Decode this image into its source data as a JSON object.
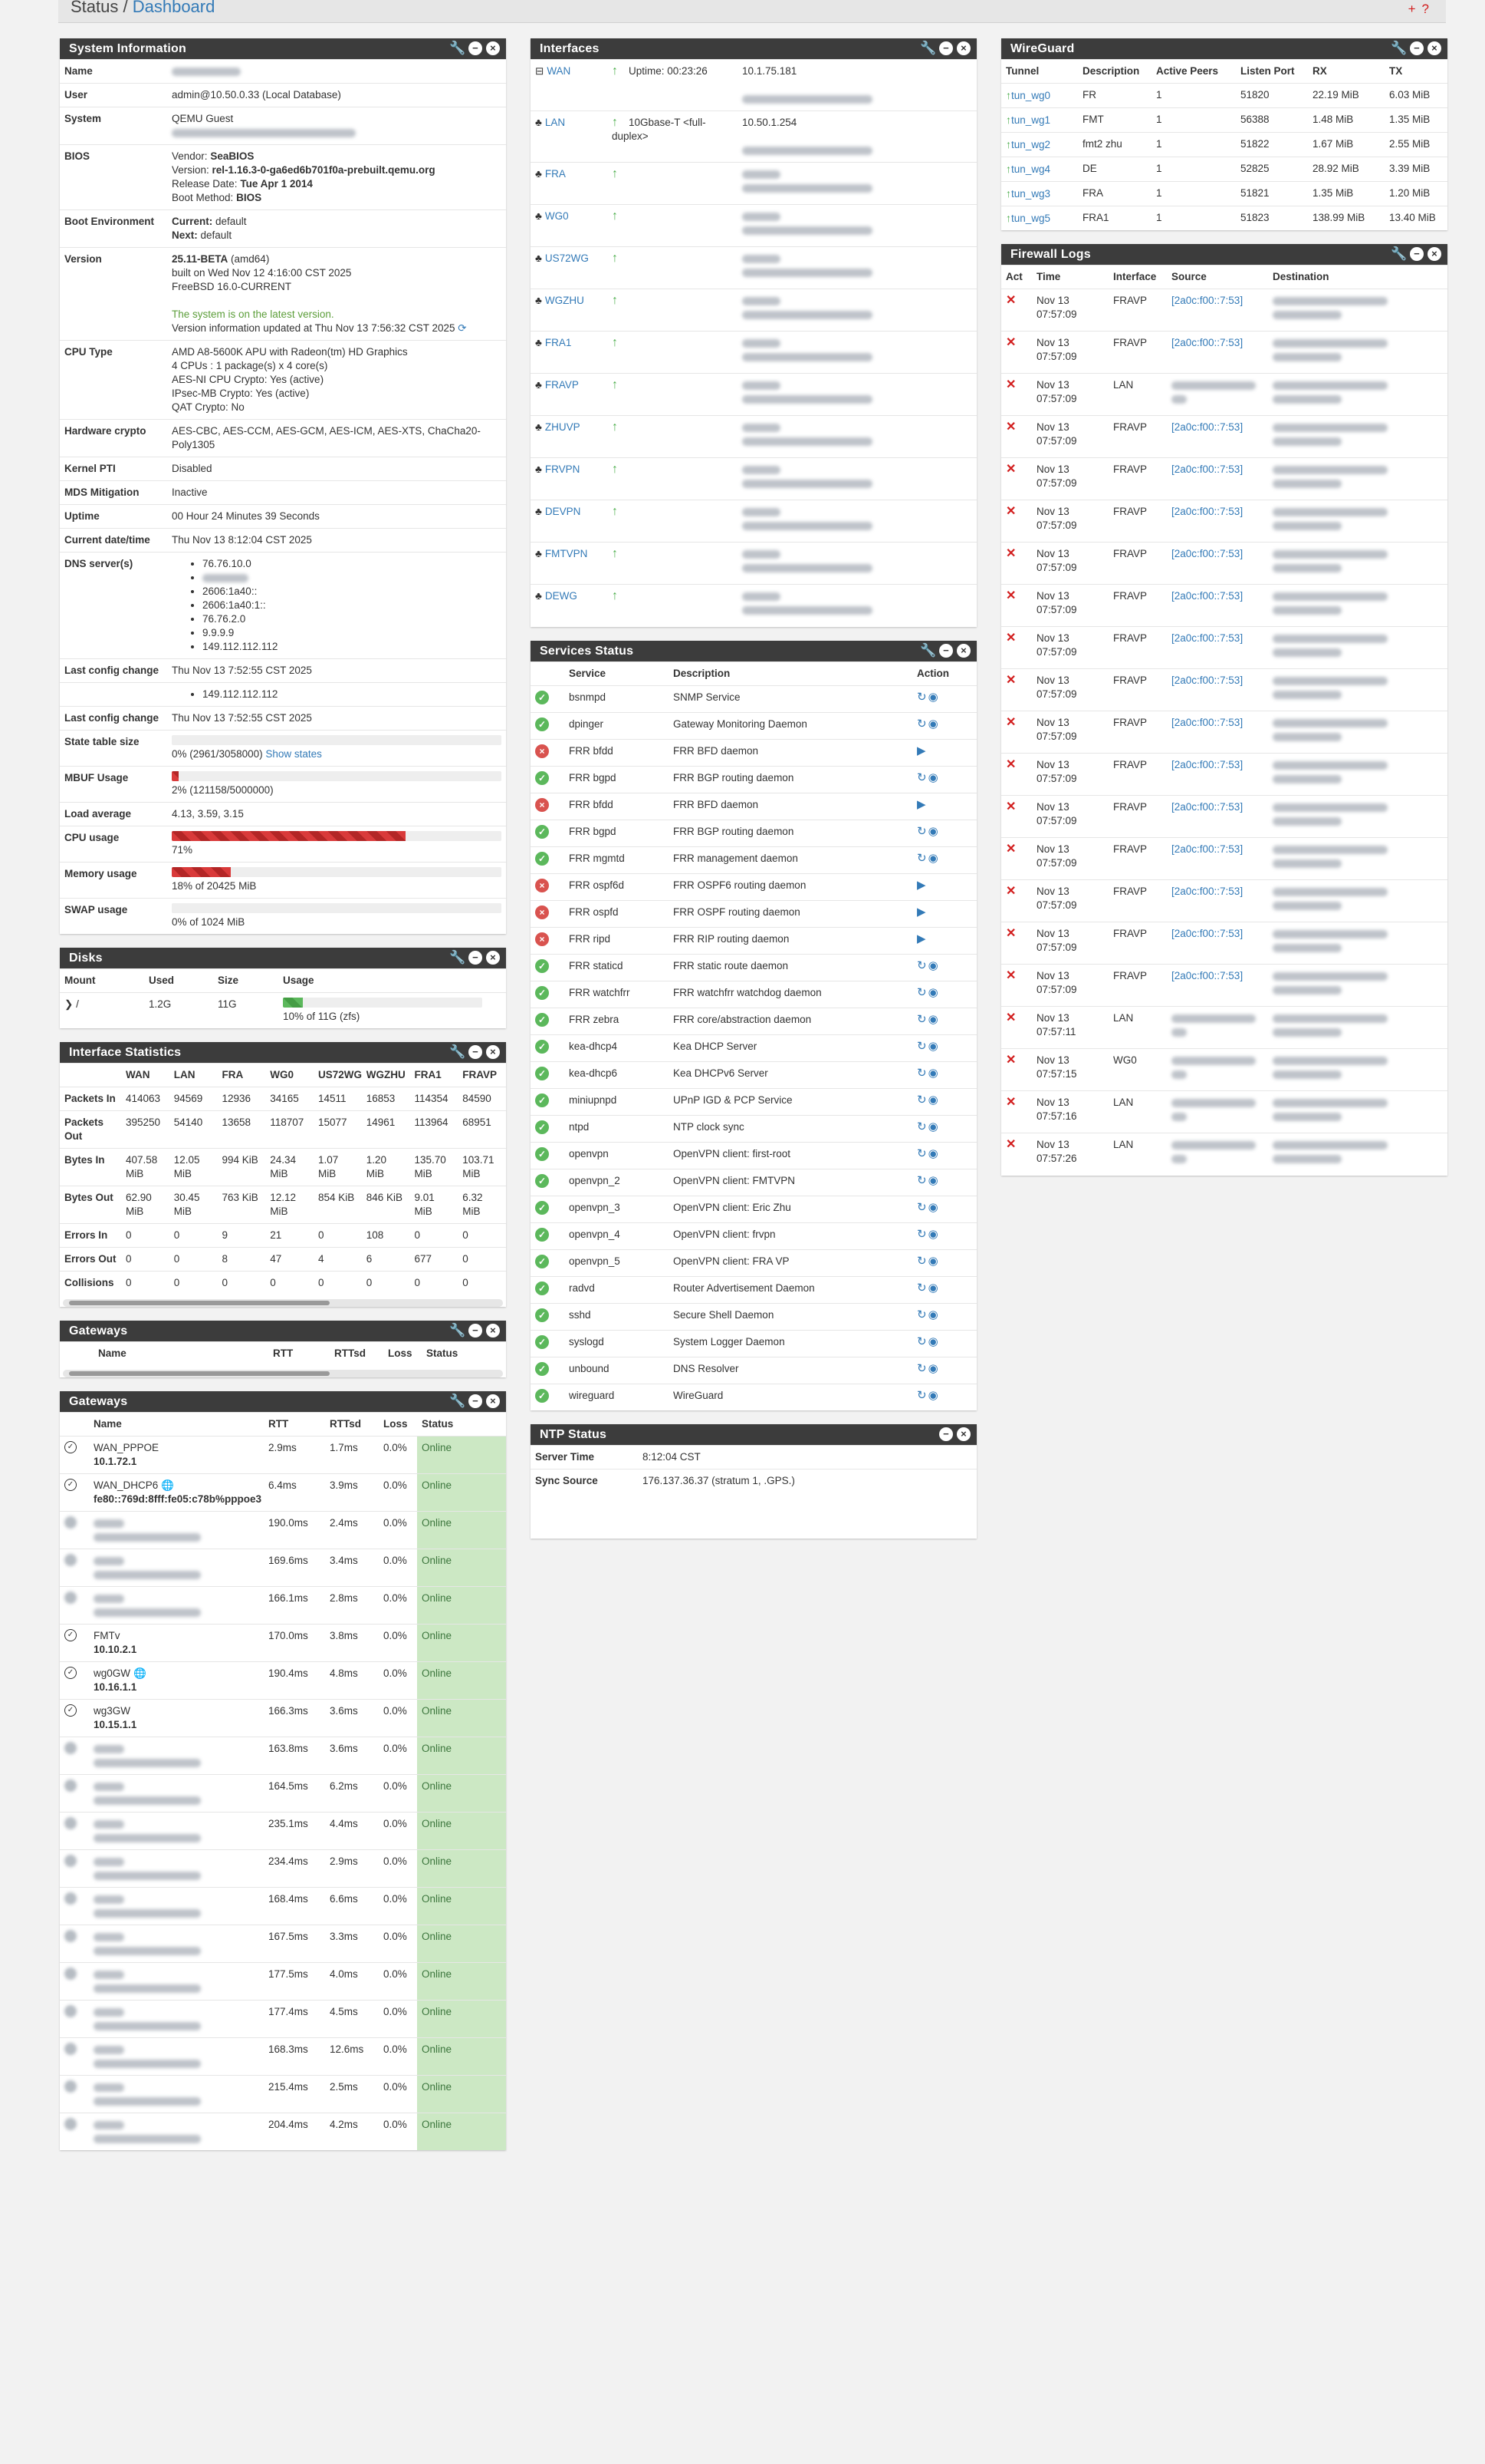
{
  "breadcrumb": {
    "status": "Status /",
    "dashboard": "Dashboard",
    "plus": "+",
    "help": "?"
  },
  "sysinfo": {
    "title": "System Information",
    "user": "admin@10.50.0.33 (Local Database)",
    "system": "QEMU Guest",
    "bios": {
      "vendor_label": "Vendor:",
      "vendor": "SeaBIOS",
      "version_label": "Version:",
      "version": "rel-1.16.3-0-ga6ed6b701f0a-prebuilt.qemu.org",
      "date_label": "Release Date:",
      "date": "Tue Apr 1 2014",
      "method_label": "Boot Method:",
      "method": "BIOS"
    },
    "boot": {
      "current_label": "Current:",
      "current": "default",
      "next_label": "Next:",
      "next": "default"
    },
    "version": {
      "ver": "25.11-BETA",
      "arch": "(amd64)",
      "built": "built on Wed Nov 12 4:16:00 CST 2025",
      "os": "FreeBSD 16.0-CURRENT",
      "latest": "The system is on the latest version.",
      "updated": "Version information updated at Thu Nov 13 7:56:32 CST 2025"
    },
    "cpu": [
      "AMD A8-5600K APU with Radeon(tm) HD Graphics",
      "4 CPUs : 1 package(s) x 4 core(s)",
      "AES-NI CPU Crypto: Yes (active)",
      "IPsec-MB Crypto: Yes (active)",
      "QAT Crypto: No"
    ],
    "hwcrypto": "AES-CBC, AES-CCM, AES-GCM, AES-ICM, AES-XTS, ChaCha20-Poly1305",
    "pti": "Disabled",
    "mds": "Inactive",
    "uptime": "00 Hour 24 Minutes 39 Seconds",
    "datetime": "Thu Nov 13 8:12:04 CST 2025",
    "dns": [
      "76.76.10.0",
      "",
      "2606:1a40::",
      "2606:1a40:1::",
      "76.76.2.0",
      "9.9.9.9",
      "149.112.112.112"
    ],
    "last_config": "Thu Nov 13 7:52:55 CST 2025",
    "dns_extra": "149.112.112.112",
    "last_config2": "Thu Nov 13 7:52:55 CST 2025",
    "state_table": "0% (2961/3058000)",
    "show_states": "Show states",
    "mbuf": "2% (121158/5000000)",
    "mbuf_pct": 2,
    "load": "4.13, 3.59, 3.15",
    "cpu_usage": "71%",
    "cpu_pct": 71,
    "memory": "18% of 20425 MiB",
    "mem_pct": 18,
    "swap": "0% of 1024 MiB",
    "swap_pct": 0,
    "labels": {
      "name": "Name",
      "user": "User",
      "system": "System",
      "bios": "BIOS",
      "boot": "Boot Environment",
      "version": "Version",
      "cpu": "CPU Type",
      "hwcrypto": "Hardware crypto",
      "pti": "Kernel PTI",
      "mds": "MDS Mitigation",
      "uptime": "Uptime",
      "datetime": "Current date/time",
      "dns": "DNS server(s)",
      "last_config": "Last config change",
      "state": "State table size",
      "mbuf": "MBUF Usage",
      "load": "Load average",
      "cpu_usage": "CPU usage",
      "memory": "Memory usage",
      "swap": "SWAP usage"
    }
  },
  "disks": {
    "title": "Disks",
    "headers": [
      "Mount",
      "Used",
      "Size",
      "Usage"
    ],
    "row": {
      "mount": "/",
      "used": "1.2G",
      "size": "11G",
      "usage": "10% of 11G (zfs)",
      "pct": 10
    }
  },
  "ifstats": {
    "title": "Interface Statistics",
    "cols": [
      "WAN",
      "LAN",
      "FRA",
      "WG0",
      "US72WG",
      "WGZHU",
      "FRA1",
      "FRAVP"
    ],
    "rows": [
      {
        "label": "Packets In",
        "vals": [
          "414063",
          "94569",
          "12936",
          "34165",
          "14511",
          "16853",
          "114354",
          "84590"
        ]
      },
      {
        "label": "Packets Out",
        "vals": [
          "395250",
          "54140",
          "13658",
          "118707",
          "15077",
          "14961",
          "113964",
          "68951"
        ]
      },
      {
        "label": "Bytes In",
        "vals": [
          "407.58 MiB",
          "12.05 MiB",
          "994 KiB",
          "24.34 MiB",
          "1.07 MiB",
          "1.20 MiB",
          "135.70 MiB",
          "103.71 MiB"
        ]
      },
      {
        "label": "Bytes Out",
        "vals": [
          "62.90 MiB",
          "30.45 MiB",
          "763 KiB",
          "12.12 MiB",
          "854 KiB",
          "846 KiB",
          "9.01 MiB",
          "6.32 MiB"
        ]
      },
      {
        "label": "Errors In",
        "vals": [
          "0",
          "0",
          "9",
          "21",
          "0",
          "108",
          "0",
          "0"
        ]
      },
      {
        "label": "Errors Out",
        "vals": [
          "0",
          "0",
          "8",
          "47",
          "4",
          "6",
          "677",
          "0"
        ]
      },
      {
        "label": "Collisions",
        "vals": [
          "0",
          "0",
          "0",
          "0",
          "0",
          "0",
          "0",
          "0"
        ]
      }
    ]
  },
  "gateways_empty": {
    "title": "Gateways",
    "headers": [
      "Name",
      "RTT",
      "RTTsd",
      "Loss",
      "Status"
    ]
  },
  "gateways": {
    "title": "Gateways",
    "headers": [
      "Name",
      "RTT",
      "RTTsd",
      "Loss",
      "Status"
    ],
    "rows": [
      {
        "name": "WAN_PPPOE",
        "addr": "10.1.72.1",
        "rtt": "2.9ms",
        "rttsd": "1.7ms",
        "loss": "0.0%",
        "status": "Online",
        "blur": false
      },
      {
        "name": "WAN_DHCP6",
        "addr": "fe80::769d:8fff:fe05:c78b%pppoe3",
        "rtt": "6.4ms",
        "rttsd": "3.9ms",
        "loss": "0.0%",
        "status": "Online",
        "blur": false,
        "globe": true
      },
      {
        "name": "",
        "addr": "",
        "rtt": "190.0ms",
        "rttsd": "2.4ms",
        "loss": "0.0%",
        "status": "Online",
        "blur": true
      },
      {
        "name": "",
        "addr": "",
        "rtt": "169.6ms",
        "rttsd": "3.4ms",
        "loss": "0.0%",
        "status": "Online",
        "blur": true
      },
      {
        "name": "",
        "addr": "",
        "rtt": "166.1ms",
        "rttsd": "2.8ms",
        "loss": "0.0%",
        "status": "Online",
        "blur": true
      },
      {
        "name": "FMTv",
        "addr": "10.10.2.1",
        "rtt": "170.0ms",
        "rttsd": "3.8ms",
        "loss": "0.0%",
        "status": "Online",
        "blur": false
      },
      {
        "name": "wg0GW",
        "addr": "10.16.1.1",
        "rtt": "190.4ms",
        "rttsd": "4.8ms",
        "loss": "0.0%",
        "status": "Online",
        "blur": false,
        "globe": true
      },
      {
        "name": "wg3GW",
        "addr": "10.15.1.1",
        "rtt": "166.3ms",
        "rttsd": "3.6ms",
        "loss": "0.0%",
        "status": "Online",
        "blur": false
      },
      {
        "name": "",
        "addr": "",
        "rtt": "163.8ms",
        "rttsd": "3.6ms",
        "loss": "0.0%",
        "status": "Online",
        "blur": true
      },
      {
        "name": "",
        "addr": "",
        "rtt": "164.5ms",
        "rttsd": "6.2ms",
        "loss": "0.0%",
        "status": "Online",
        "blur": true
      },
      {
        "name": "",
        "addr": "",
        "rtt": "235.1ms",
        "rttsd": "4.4ms",
        "loss": "0.0%",
        "status": "Online",
        "blur": true
      },
      {
        "name": "",
        "addr": "",
        "rtt": "234.4ms",
        "rttsd": "2.9ms",
        "loss": "0.0%",
        "status": "Online",
        "blur": true
      },
      {
        "name": "",
        "addr": "",
        "rtt": "168.4ms",
        "rttsd": "6.6ms",
        "loss": "0.0%",
        "status": "Online",
        "blur": true
      },
      {
        "name": "",
        "addr": "",
        "rtt": "167.5ms",
        "rttsd": "3.3ms",
        "loss": "0.0%",
        "status": "Online",
        "blur": true
      },
      {
        "name": "",
        "addr": "",
        "rtt": "177.5ms",
        "rttsd": "4.0ms",
        "loss": "0.0%",
        "status": "Online",
        "blur": true
      },
      {
        "name": "",
        "addr": "",
        "rtt": "177.4ms",
        "rttsd": "4.5ms",
        "loss": "0.0%",
        "status": "Online",
        "blur": true
      },
      {
        "name": "",
        "addr": "",
        "rtt": "168.3ms",
        "rttsd": "12.6ms",
        "loss": "0.0%",
        "status": "Online",
        "blur": true
      },
      {
        "name": "",
        "addr": "",
        "rtt": "215.4ms",
        "rttsd": "2.5ms",
        "loss": "0.0%",
        "status": "Online",
        "blur": true
      },
      {
        "name": "",
        "addr": "",
        "rtt": "204.4ms",
        "rttsd": "4.2ms",
        "loss": "0.0%",
        "status": "Online",
        "blur": true
      }
    ]
  },
  "interfaces": {
    "title": "Interfaces",
    "rows": [
      {
        "name": "WAN",
        "info": "Uptime: 00:23:26",
        "ip": "10.1.75.181",
        "ip_blur": false
      },
      {
        "name": "LAN",
        "info": "10Gbase-T <full-duplex>",
        "ip": "10.50.1.254",
        "ip_blur": false
      },
      {
        "name": "FRA",
        "info": "",
        "ip": "",
        "ip_blur": true
      },
      {
        "name": "WG0",
        "info": "",
        "ip": "",
        "ip_blur": true
      },
      {
        "name": "US72WG",
        "info": "",
        "ip": "",
        "ip_blur": true
      },
      {
        "name": "WGZHU",
        "info": "",
        "ip": "",
        "ip_blur": true
      },
      {
        "name": "FRA1",
        "info": "",
        "ip": "",
        "ip_blur": true
      },
      {
        "name": "FRAVP",
        "info": "",
        "ip": "",
        "ip_blur": true
      },
      {
        "name": "ZHUVP",
        "info": "",
        "ip": "",
        "ip_blur": true
      },
      {
        "name": "FRVPN",
        "info": "",
        "ip": "",
        "ip_blur": true
      },
      {
        "name": "DEVPN",
        "info": "",
        "ip": "",
        "ip_blur": true
      },
      {
        "name": "FMTVPN",
        "info": "",
        "ip": "",
        "ip_blur": true
      },
      {
        "name": "DEWG",
        "info": "",
        "ip": "",
        "ip_blur": true
      }
    ]
  },
  "services": {
    "title": "Services Status",
    "headers": [
      "Service",
      "Description",
      "Action"
    ],
    "rows": [
      {
        "name": "bsnmpd",
        "desc": "SNMP Service",
        "on": true
      },
      {
        "name": "dpinger",
        "desc": "Gateway Monitoring Daemon",
        "on": true
      },
      {
        "name": "FRR bfdd",
        "desc": "FRR BFD daemon",
        "on": false
      },
      {
        "name": "FRR bgpd",
        "desc": "FRR BGP routing daemon",
        "on": true
      },
      {
        "name": "FRR bfdd",
        "desc": "FRR BFD daemon",
        "on": false
      },
      {
        "name": "FRR bgpd",
        "desc": "FRR BGP routing daemon",
        "on": true
      },
      {
        "name": "FRR mgmtd",
        "desc": "FRR management daemon",
        "on": true
      },
      {
        "name": "FRR ospf6d",
        "desc": "FRR OSPF6 routing daemon",
        "on": false
      },
      {
        "name": "FRR ospfd",
        "desc": "FRR OSPF routing daemon",
        "on": false
      },
      {
        "name": "FRR ripd",
        "desc": "FRR RIP routing daemon",
        "on": false
      },
      {
        "name": "FRR staticd",
        "desc": "FRR static route daemon",
        "on": true
      },
      {
        "name": "FRR watchfrr",
        "desc": "FRR watchfrr watchdog daemon",
        "on": true
      },
      {
        "name": "FRR zebra",
        "desc": "FRR core/abstraction daemon",
        "on": true
      },
      {
        "name": "kea-dhcp4",
        "desc": "Kea DHCP Server",
        "on": true
      },
      {
        "name": "kea-dhcp6",
        "desc": "Kea DHCPv6 Server",
        "on": true
      },
      {
        "name": "miniupnpd",
        "desc": "UPnP IGD & PCP Service",
        "on": true
      },
      {
        "name": "ntpd",
        "desc": "NTP clock sync",
        "on": true
      },
      {
        "name": "openvpn",
        "desc": "OpenVPN client: first-root",
        "on": true
      },
      {
        "name": "openvpn_2",
        "desc": "OpenVPN client: FMTVPN",
        "on": true
      },
      {
        "name": "openvpn_3",
        "desc": "OpenVPN client: Eric Zhu",
        "on": true
      },
      {
        "name": "openvpn_4",
        "desc": "OpenVPN client: frvpn",
        "on": true
      },
      {
        "name": "openvpn_5",
        "desc": "OpenVPN client: FRA VP",
        "on": true
      },
      {
        "name": "radvd",
        "desc": "Router Advertisement Daemon",
        "on": true
      },
      {
        "name": "sshd",
        "desc": "Secure Shell Daemon",
        "on": true
      },
      {
        "name": "syslogd",
        "desc": "System Logger Daemon",
        "on": true
      },
      {
        "name": "unbound",
        "desc": "DNS Resolver",
        "on": true
      },
      {
        "name": "wireguard",
        "desc": "WireGuard",
        "on": true
      }
    ]
  },
  "ntp": {
    "title": "NTP Status",
    "server_label": "Server Time",
    "server": "8:12:04 CST",
    "sync_label": "Sync Source",
    "sync": "176.137.36.37 (stratum 1, .GPS.)"
  },
  "wireguard": {
    "title": "WireGuard",
    "headers": [
      "Tunnel",
      "Description",
      "Active Peers",
      "Listen Port",
      "RX",
      "TX"
    ],
    "rows": [
      {
        "tunnel": "tun_wg0",
        "desc": "FR",
        "peers": "1",
        "port": "51820",
        "rx": "22.19 MiB",
        "tx": "6.03 MiB"
      },
      {
        "tunnel": "tun_wg1",
        "desc": "FMT",
        "peers": "1",
        "port": "56388",
        "rx": "1.48 MiB",
        "tx": "1.35 MiB"
      },
      {
        "tunnel": "tun_wg2",
        "desc": "fmt2 zhu",
        "peers": "1",
        "port": "51822",
        "rx": "1.67 MiB",
        "tx": "2.55 MiB"
      },
      {
        "tunnel": "tun_wg4",
        "desc": "DE",
        "peers": "1",
        "port": "52825",
        "rx": "28.92 MiB",
        "tx": "3.39 MiB"
      },
      {
        "tunnel": "tun_wg3",
        "desc": "FRA",
        "peers": "1",
        "port": "51821",
        "rx": "1.35 MiB",
        "tx": "1.20 MiB"
      },
      {
        "tunnel": "tun_wg5",
        "desc": "FRA1",
        "peers": "1",
        "port": "51823",
        "rx": "138.99 MiB",
        "tx": "13.40 MiB"
      }
    ]
  },
  "fwlogs": {
    "title": "Firewall Logs",
    "headers": [
      "Act",
      "Time",
      "Interface",
      "Source",
      "Destination"
    ],
    "rows": [
      {
        "date": "Nov 13",
        "time": "07:57:09",
        "iface": "FRAVP",
        "src": "[2a0c:f00::7:53]",
        "blur_src": false
      },
      {
        "date": "Nov 13",
        "time": "07:57:09",
        "iface": "FRAVP",
        "src": "[2a0c:f00::7:53]",
        "blur_src": false
      },
      {
        "date": "Nov 13",
        "time": "07:57:09",
        "iface": "LAN",
        "src": "",
        "blur_src": true
      },
      {
        "date": "Nov 13",
        "time": "07:57:09",
        "iface": "FRAVP",
        "src": "[2a0c:f00::7:53]",
        "blur_src": false
      },
      {
        "date": "Nov 13",
        "time": "07:57:09",
        "iface": "FRAVP",
        "src": "[2a0c:f00::7:53]",
        "blur_src": false
      },
      {
        "date": "Nov 13",
        "time": "07:57:09",
        "iface": "FRAVP",
        "src": "[2a0c:f00::7:53]",
        "blur_src": false
      },
      {
        "date": "Nov 13",
        "time": "07:57:09",
        "iface": "FRAVP",
        "src": "[2a0c:f00::7:53]",
        "blur_src": false
      },
      {
        "date": "Nov 13",
        "time": "07:57:09",
        "iface": "FRAVP",
        "src": "[2a0c:f00::7:53]",
        "blur_src": false
      },
      {
        "date": "Nov 13",
        "time": "07:57:09",
        "iface": "FRAVP",
        "src": "[2a0c:f00::7:53]",
        "blur_src": false
      },
      {
        "date": "Nov 13",
        "time": "07:57:09",
        "iface": "FRAVP",
        "src": "[2a0c:f00::7:53]",
        "blur_src": false
      },
      {
        "date": "Nov 13",
        "time": "07:57:09",
        "iface": "FRAVP",
        "src": "[2a0c:f00::7:53]",
        "blur_src": false
      },
      {
        "date": "Nov 13",
        "time": "07:57:09",
        "iface": "FRAVP",
        "src": "[2a0c:f00::7:53]",
        "blur_src": false
      },
      {
        "date": "Nov 13",
        "time": "07:57:09",
        "iface": "FRAVP",
        "src": "[2a0c:f00::7:53]",
        "blur_src": false
      },
      {
        "date": "Nov 13",
        "time": "07:57:09",
        "iface": "FRAVP",
        "src": "[2a0c:f00::7:53]",
        "blur_src": false
      },
      {
        "date": "Nov 13",
        "time": "07:57:09",
        "iface": "FRAVP",
        "src": "[2a0c:f00::7:53]",
        "blur_src": false
      },
      {
        "date": "Nov 13",
        "time": "07:57:09",
        "iface": "FRAVP",
        "src": "[2a0c:f00::7:53]",
        "blur_src": false
      },
      {
        "date": "Nov 13",
        "time": "07:57:09",
        "iface": "FRAVP",
        "src": "[2a0c:f00::7:53]",
        "blur_src": false
      },
      {
        "date": "Nov 13",
        "time": "07:57:11",
        "iface": "LAN",
        "src": "",
        "blur_src": true
      },
      {
        "date": "Nov 13",
        "time": "07:57:15",
        "iface": "WG0",
        "src": "",
        "blur_src": true
      },
      {
        "date": "Nov 13",
        "time": "07:57:16",
        "iface": "LAN",
        "src": "",
        "blur_src": true
      },
      {
        "date": "Nov 13",
        "time": "07:57:26",
        "iface": "LAN",
        "src": "",
        "blur_src": true
      }
    ]
  }
}
